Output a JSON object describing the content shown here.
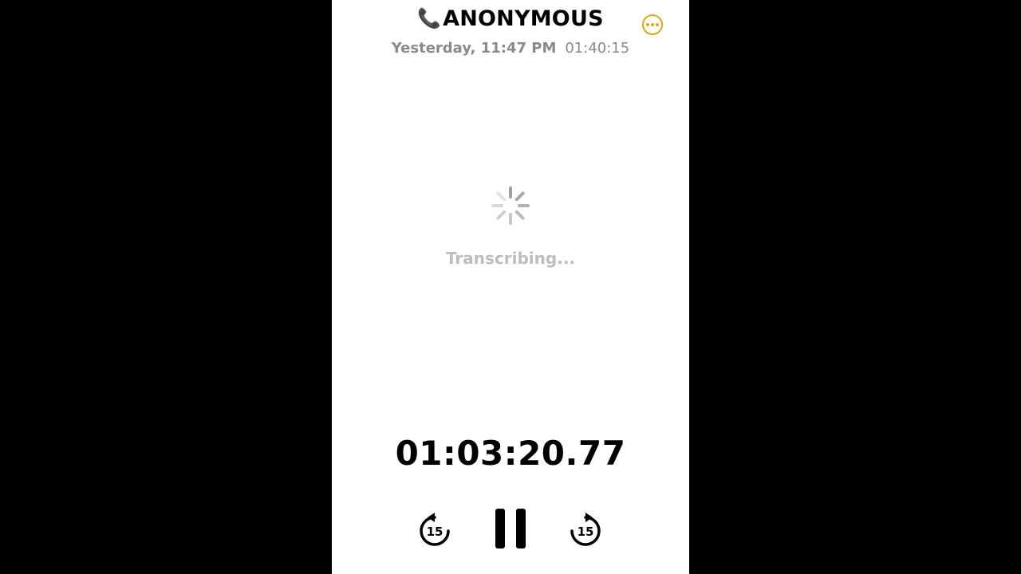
{
  "header": {
    "phone_icon": "📞",
    "title": "ANONYMOUS",
    "date": "Yesterday, 11:47 PM",
    "duration": "01:40:15",
    "more_icon": "ellipsis-circle-icon"
  },
  "main": {
    "status": "Transcribing..."
  },
  "player": {
    "elapsed": "01:03:20.77",
    "skip_back_label": "15",
    "skip_forward_label": "15"
  },
  "colors": {
    "accent": "#d9a91a",
    "background": "#ffffff",
    "letterbox": "#000000",
    "muted_text": "#8a8a8a",
    "status_text": "#bdbdbd"
  }
}
